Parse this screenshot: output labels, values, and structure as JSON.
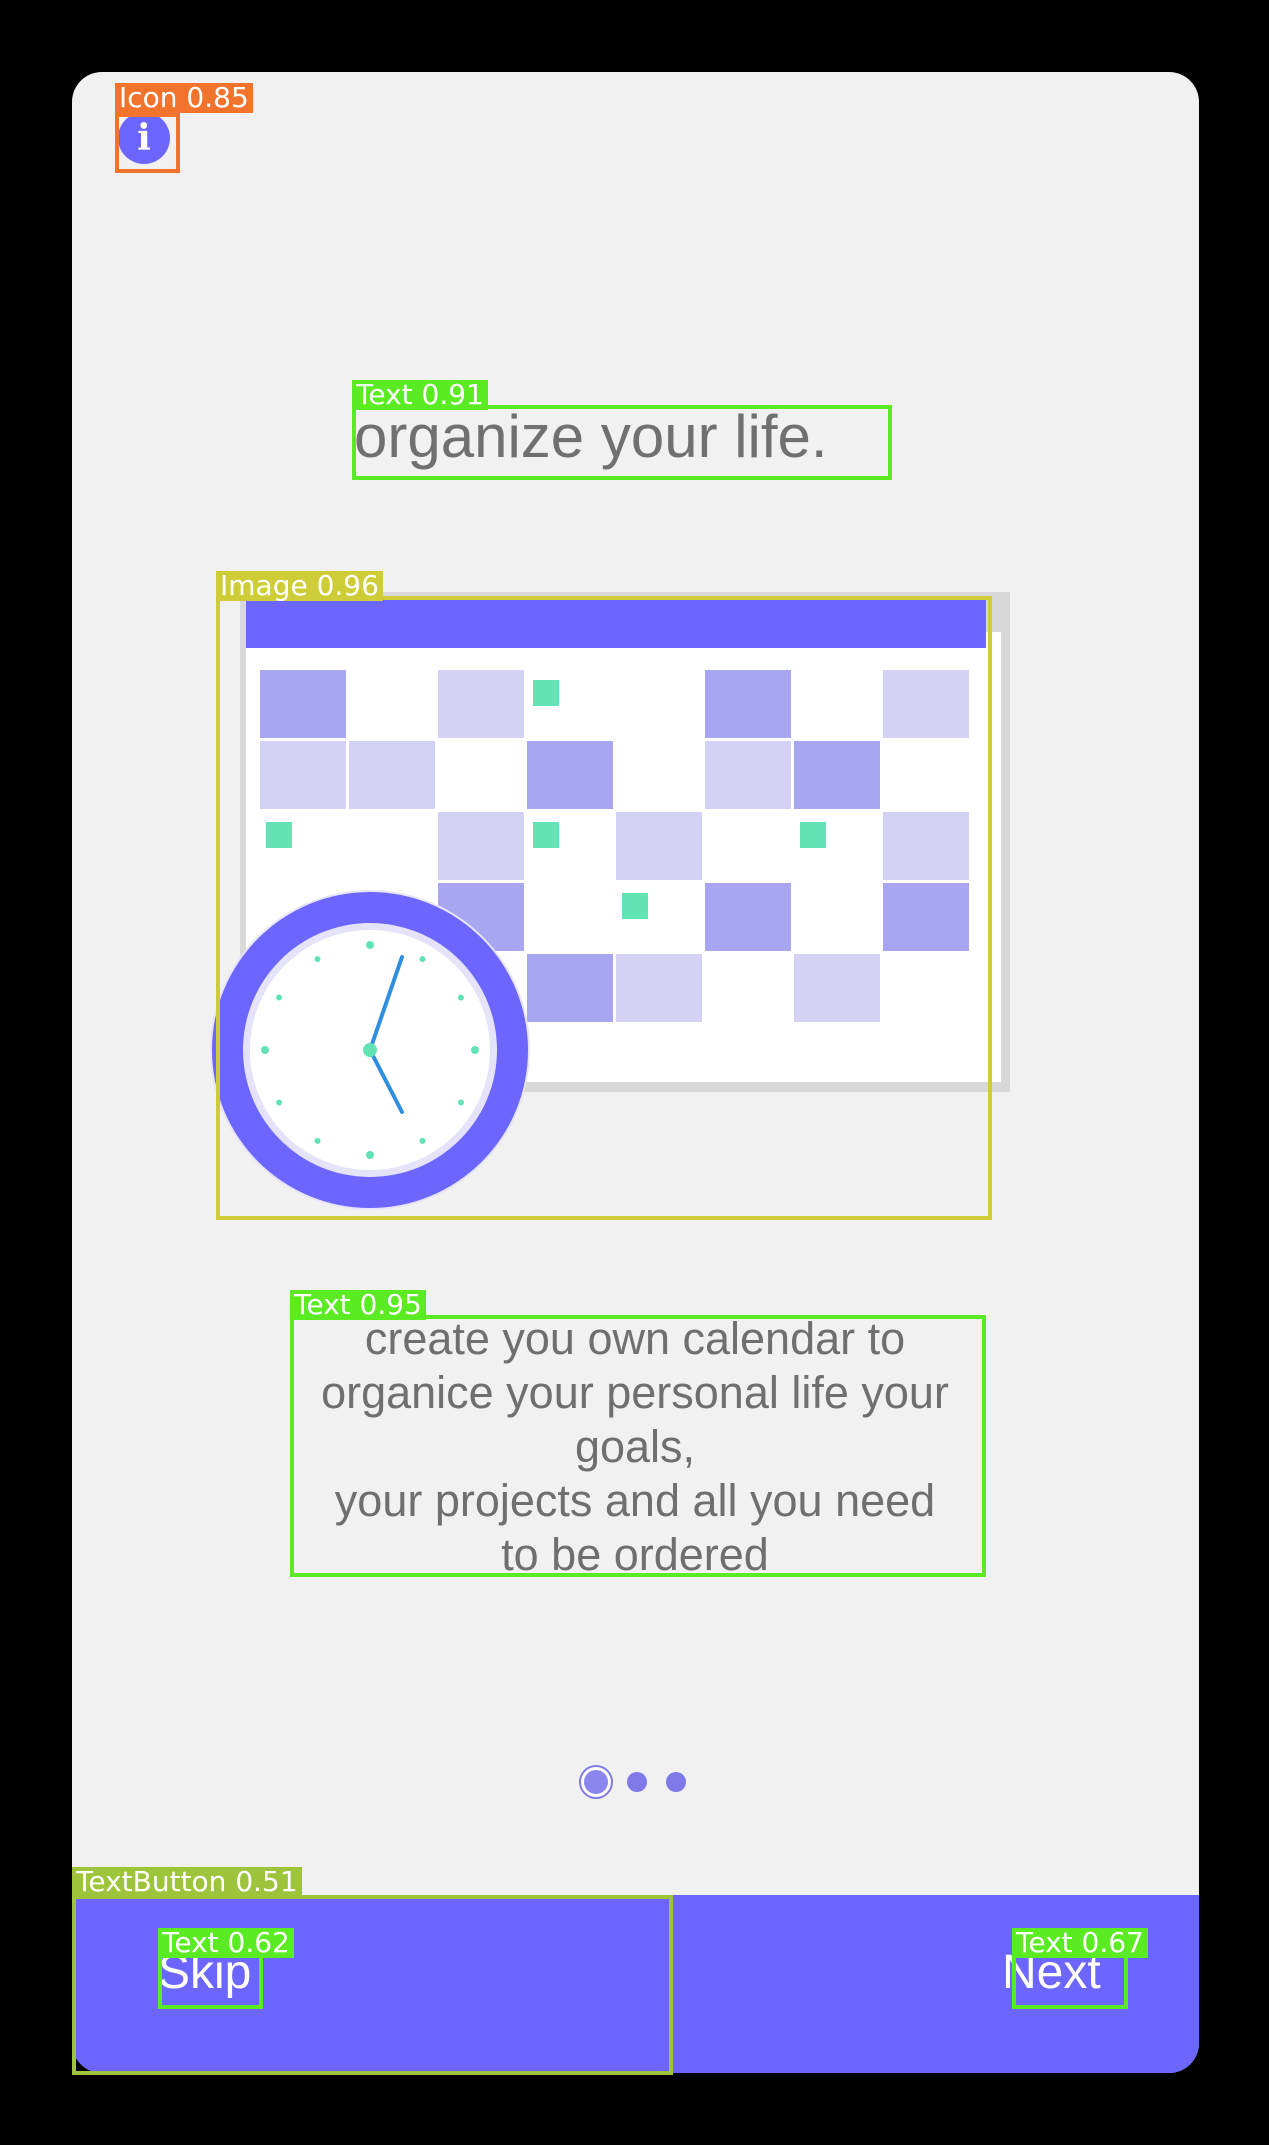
{
  "colors": {
    "accent": "#6c66ff",
    "light_accent": "#a9a6f1",
    "pale_accent": "#d3d1f4",
    "mint": "#62e3b4",
    "clock_blue": "#2f8fde",
    "screen_bg": "#f1f1f1",
    "detection_green": "#5aeb23",
    "detection_yellow": "#cfcd37",
    "detection_orange": "#f2732c",
    "detection_olive": "#9dc43a"
  },
  "header": {
    "info_icon": "info-icon",
    "info_glyph": "i"
  },
  "title": "organize your life.",
  "illustration": {
    "icon": "calendar-with-clock-illustration"
  },
  "description": "create you own calendar to\norganice your personal life your\ngoals,\n your projects and  all you need\nto be ordered",
  "pagination": {
    "current_page": 1,
    "total_pages": 3
  },
  "footer": {
    "skip_label": "Skip",
    "next_label": "Next"
  },
  "annotations": [
    {
      "label": "Icon 0.85",
      "class": "Icon",
      "score": 0.85
    },
    {
      "label": "Text 0.91",
      "class": "Text",
      "score": 0.91
    },
    {
      "label": "Image 0.96",
      "class": "Image",
      "score": 0.96
    },
    {
      "label": "Text 0.95",
      "class": "Text",
      "score": 0.95
    },
    {
      "label": "TextButton 0.51",
      "class": "TextButton",
      "score": 0.51
    },
    {
      "label": "Text 0.62",
      "class": "Text",
      "score": 0.62
    },
    {
      "label": "Text 0.67",
      "class": "Text",
      "score": 0.67
    }
  ]
}
